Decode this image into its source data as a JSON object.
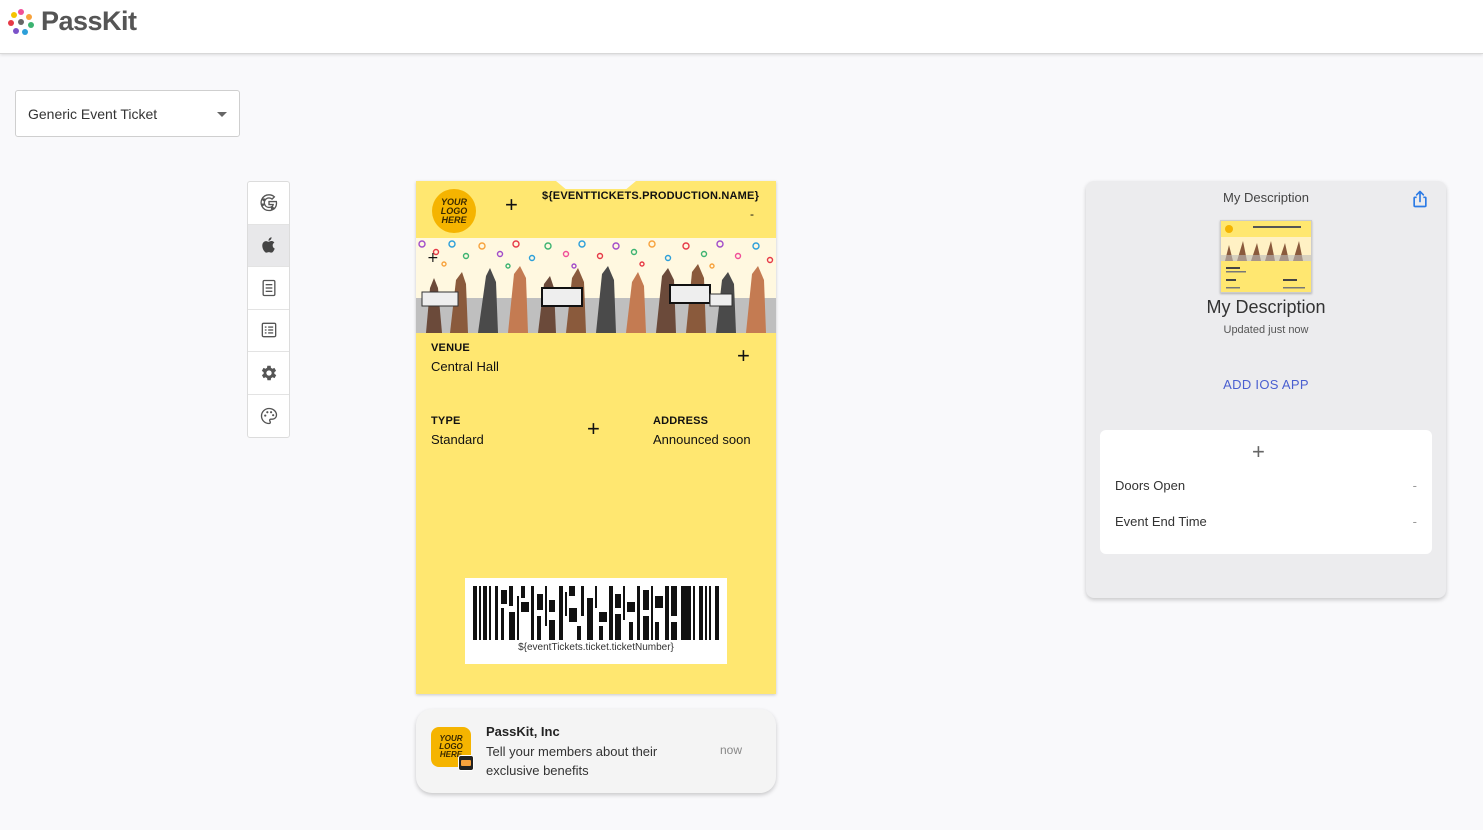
{
  "header": {
    "brand_name": "PassKit"
  },
  "template_select": {
    "value": "Generic Event Ticket"
  },
  "toolbar": {
    "items": [
      {
        "name": "google-icon",
        "active": false
      },
      {
        "name": "apple-icon",
        "active": true
      },
      {
        "name": "document-icon",
        "active": false
      },
      {
        "name": "list-icon",
        "active": false
      },
      {
        "name": "gear-icon",
        "active": false
      },
      {
        "name": "palette-icon",
        "active": false
      }
    ]
  },
  "pass": {
    "logo_text": "YOUR LOGO HERE",
    "production_name": "${EVENTTICKETS.PRODUCTION.NAME}",
    "production_dash": "-",
    "venue_label": "VENUE",
    "venue_value": "Central Hall",
    "type_label": "TYPE",
    "type_value": "Standard",
    "address_label": "ADDRESS",
    "address_value": "Announced soon",
    "barcode_text": "${eventTickets.ticket.ticketNumber}",
    "background_color": "#ffe770"
  },
  "notification": {
    "logo_text": "YOUR LOGO HERE",
    "title": "PassKit, Inc",
    "body": "Tell your members about their exclusive benefits",
    "time": "now"
  },
  "panel": {
    "top_title": "My Description",
    "title": "My Description",
    "subtitle": "Updated just now",
    "add_app_label": "ADD IOS APP",
    "back_fields": [
      {
        "label": "Doors Open",
        "value": "-"
      },
      {
        "label": "Event End Time",
        "value": "-"
      }
    ]
  },
  "colors": {
    "accent": "#4a5fd0",
    "share": "#2c7be5",
    "pass_bg": "#ffe770",
    "logo": "#f5b400"
  }
}
